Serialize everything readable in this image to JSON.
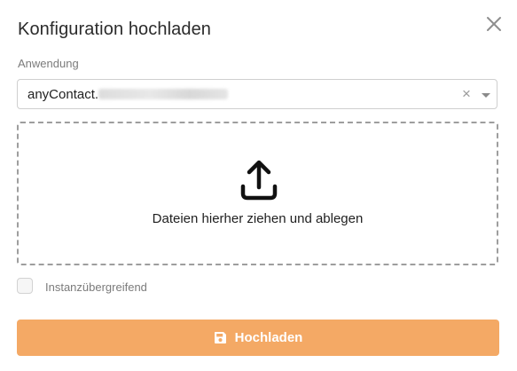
{
  "dialog": {
    "title": "Konfiguration hochladen",
    "close_icon": "close-icon"
  },
  "application_field": {
    "label": "Anwendung",
    "selected_value": "anyContact.",
    "clear_icon": "×",
    "dropdown_icon": "chevron-down-icon"
  },
  "dropzone": {
    "icon": "upload-icon",
    "text": "Dateien hierher ziehen und ablegen"
  },
  "cross_instance": {
    "label": "Instanzübergreifend",
    "checked": false
  },
  "submit": {
    "icon": "save-icon",
    "label": "Hochladen",
    "color": "#f4a965"
  }
}
